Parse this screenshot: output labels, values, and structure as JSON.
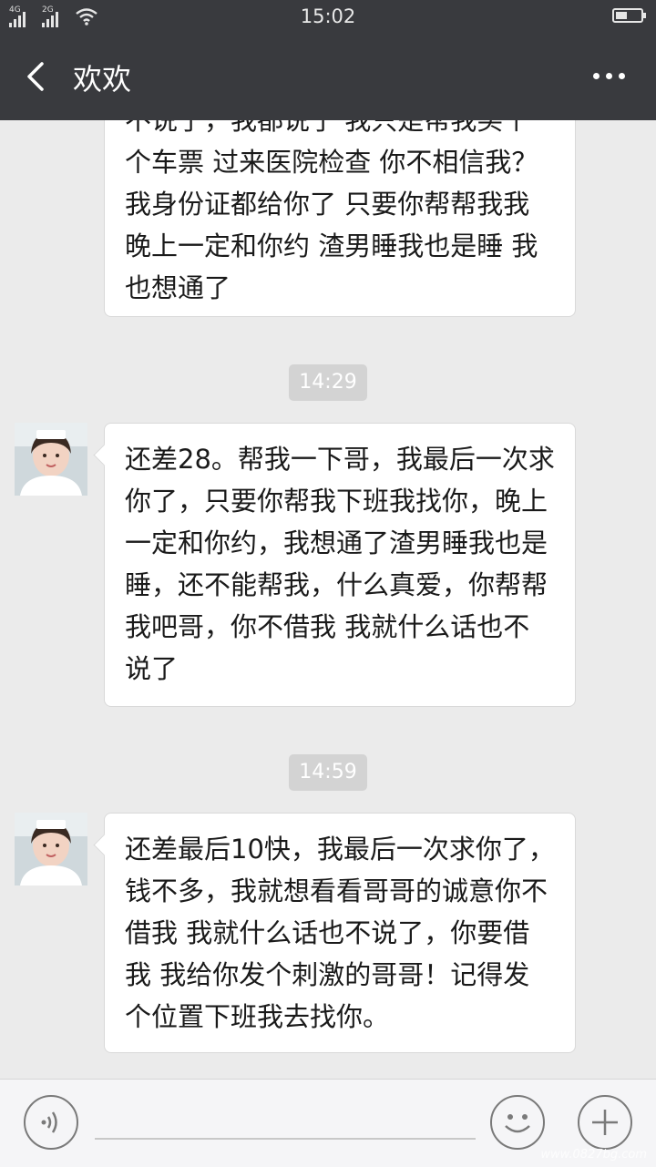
{
  "status_bar": {
    "time": "15:02",
    "network1_label": "4G",
    "network2_label": "2G",
    "wifi_icon": "wifi-icon",
    "battery_icon": "battery-icon"
  },
  "header": {
    "title": "欢欢",
    "back_icon": "chevron-left-icon",
    "more_icon": "more-dots-icon"
  },
  "messages": [
    {
      "type": "incoming",
      "text": "个车票 过来医院检查 你不相信我？我身份证都给你了 只要你帮帮我我晚上一定和你约 渣男睡我也是睡 我也想通了",
      "partial_top_text": "不说了，我都说了 我只是帮我买个"
    },
    {
      "type": "time",
      "text": "14:29"
    },
    {
      "type": "incoming",
      "text": "还差28。帮我一下哥，我最后一次求你了，只要你帮我下班我找你，晚上一定和你约，我想通了渣男睡我也是睡，还不能帮我，什么真爱，你帮帮我吧哥，你不借我 我就什么话也不说了"
    },
    {
      "type": "time",
      "text": "14:59"
    },
    {
      "type": "incoming",
      "text": "还差最后10快，我最后一次求你了，钱不多，我就想看看哥哥的诚意你不借我 我就什么话也不说了，你要借我 我给你发个刺激的哥哥！记得发个位置下班我去找你。"
    }
  ],
  "input_bar": {
    "voice_icon": "voice-icon",
    "emoji_icon": "smiley-icon",
    "plus_icon": "plus-icon"
  },
  "watermark": "www.0827bg.com"
}
